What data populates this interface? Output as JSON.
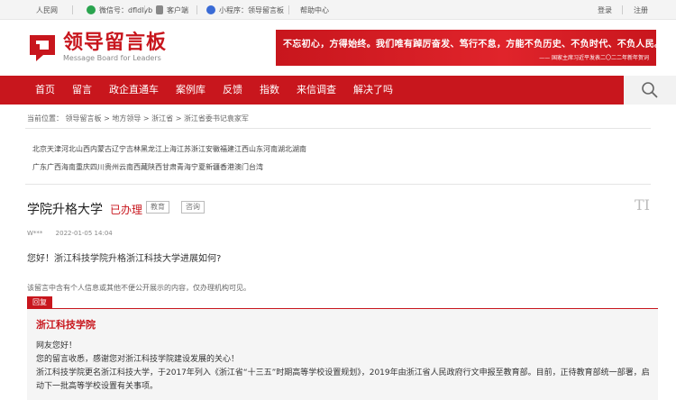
{
  "topbar": {
    "people_daily": "人民网",
    "wechat": "微信号：dfldlyb",
    "app": "客户端",
    "miniprogram": "小程序：领导留言板",
    "help": "帮助中心",
    "login": "登录",
    "register": "注册"
  },
  "header": {
    "logo_cn": "领导留言板",
    "logo_en": "Message Board for Leaders",
    "banner_main": "不忘初心，方得始终。我们唯有踔厉奋发、笃行不怠，方能不负历史、不负时代、不负人民。",
    "banner_sub": "—— 国家主席习近平发表二〇二二年新年贺词"
  },
  "nav": {
    "items": [
      "首页",
      "留言",
      "政企直通车",
      "案例库",
      "反馈",
      "指数",
      "来信调查",
      "解决了吗"
    ]
  },
  "breadcrumb": {
    "prefix": "当前位置：",
    "items": [
      "领导留言板",
      "地方领导",
      "浙江省",
      "浙江省委书记袁家军"
    ],
    "separator": ">"
  },
  "provinces": {
    "row1": [
      "北京",
      "天津",
      "河北",
      "山西",
      "内蒙古",
      "辽宁",
      "吉林",
      "黑龙江",
      "上海",
      "江苏",
      "浙江",
      "安徽",
      "福建",
      "江西",
      "山东",
      "河南",
      "湖北",
      "湖南"
    ],
    "row2": [
      "广东",
      "广西",
      "海南",
      "重庆",
      "四川",
      "贵州",
      "云南",
      "西藏",
      "陕西",
      "甘肃",
      "青海",
      "宁夏",
      "新疆",
      "香港",
      "澳门",
      "台湾"
    ]
  },
  "message": {
    "title": "学院升格大学",
    "status": "已办理",
    "tags": [
      "教育",
      "咨询"
    ],
    "font_toggle": "TI",
    "author": "W***",
    "date": "2022-01-05 14:04",
    "question": "您好！浙江科技学院升格浙江科技大学进展如何?",
    "notice": "该留言中含有个人信息或其他不便公开展示的内容，仅办理机构可见。"
  },
  "reply": {
    "tab_label": "回复",
    "org": "浙江科技学院",
    "lines": [
      "网友您好！",
      "您的留言收悉，感谢您对浙江科技学院建设发展的关心！",
      "浙江科技学院更名浙江科技大学，于2017年列入《浙江省“十三五”时期高等学校设置规划》，2019年由浙江省人民政府行文申报至教育部。目前，正待教育部统一部署，启动下一批高等学校设置有关事项。"
    ]
  },
  "colors": {
    "brand_red": "#c8161d",
    "nav_bg": "#c8161d",
    "reply_bg": "#f5f5f5"
  },
  "icons": {
    "wechat": "wechat-icon",
    "app": "phone-icon",
    "miniprogram": "miniprogram-icon",
    "search": "search-icon"
  }
}
